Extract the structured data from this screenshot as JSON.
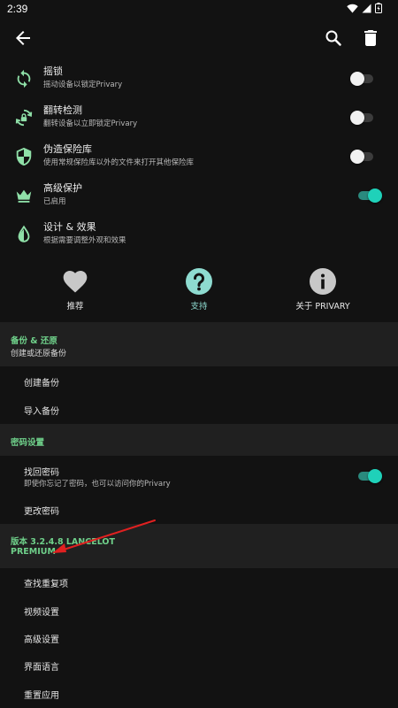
{
  "status_bar": {
    "time": "2:39",
    "icons": [
      "wifi-icon",
      "signal-icon",
      "battery-icon"
    ]
  },
  "app_bar": {
    "icons": [
      "back-arrow-icon",
      "search-icon",
      "trash-icon"
    ]
  },
  "settings": [
    {
      "id": "shake-lock",
      "title": "摇锁",
      "subtitle": "摇动设备以锁定Privary",
      "icon": "sync-icon",
      "toggle": false
    },
    {
      "id": "flip-detect",
      "title": "翻转检测",
      "subtitle": "翻转设备以立即锁定Privary",
      "icon": "rotate-lock-icon",
      "toggle": false
    },
    {
      "id": "fake-vault",
      "title": "伪造保险库",
      "subtitle": "使用常规保险库以外的文件来打开其他保险库",
      "icon": "shield-icon",
      "toggle": false
    },
    {
      "id": "advanced-protection",
      "title": "高级保护",
      "subtitle": "已启用",
      "icon": "crown-icon",
      "toggle": true
    },
    {
      "id": "design-effects",
      "title": "设计 & 效果",
      "subtitle": "根据需要调整外观和效果",
      "icon": "drop-icon",
      "toggle": null
    }
  ],
  "actions": [
    {
      "id": "recommend",
      "label": "推荐",
      "icon": "heart-icon"
    },
    {
      "id": "support",
      "label": "支持",
      "icon": "question-icon"
    },
    {
      "id": "about",
      "label": "关于 PRIVARY",
      "icon": "info-icon"
    }
  ],
  "backup_section": {
    "title": "备份 & 还原",
    "subtitle": "创建或还原备份",
    "items": [
      "创建备份",
      "导入备份"
    ]
  },
  "password_section": {
    "title": "密码设置",
    "recover": {
      "label": "找回密码",
      "subtitle": "即使你忘记了密码，也可以访问你的Privary",
      "toggle": true
    },
    "change_password": "更改密码"
  },
  "version_section": {
    "title_line1": "版本 3.2.4.8 LANCELOT",
    "title_line2": "PREMIUM"
  },
  "bottom_items": [
    "查找重复项",
    "视频设置",
    "高级设置",
    "界面语言",
    "重置应用"
  ],
  "colors": {
    "background": "#121212",
    "section_background": "#202020",
    "icon_green": "#8fe0a8",
    "section_title_green": "#6fd08a",
    "switch_on_thumb": "#1fd1b9",
    "switch_on_track": "#2a8a7e",
    "action_gray": "#c8c8c8",
    "support_teal": "#8edbd0",
    "annotation_red": "#e02020"
  }
}
